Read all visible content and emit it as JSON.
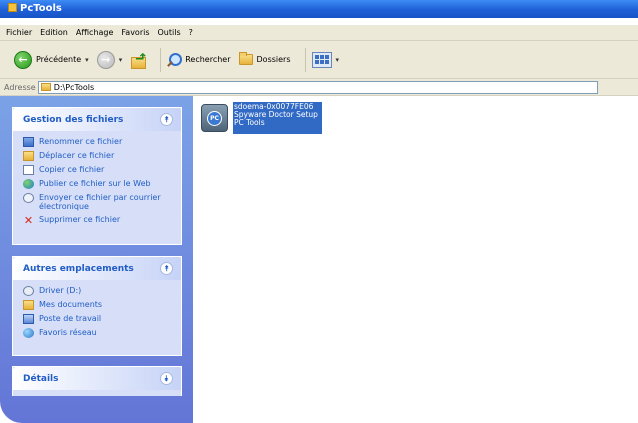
{
  "window": {
    "title": "PcTools"
  },
  "menu": [
    "Fichier",
    "Edition",
    "Affichage",
    "Favoris",
    "Outils",
    "?"
  ],
  "toolbar": {
    "back_label": "Précédente",
    "search_label": "Rechercher",
    "folders_label": "Dossiers"
  },
  "address": {
    "label": "Adresse",
    "path": "D:\\PcTools"
  },
  "tasks_panel": {
    "title": "Gestion des fichiers",
    "items": [
      {
        "label": "Renommer ce fichier",
        "icon": "rename-icon"
      },
      {
        "label": "Déplacer ce fichier",
        "icon": "move-icon"
      },
      {
        "label": "Copier ce fichier",
        "icon": "copy-icon"
      },
      {
        "label": "Publier ce fichier sur le Web",
        "icon": "web-publish-icon"
      },
      {
        "label": "Envoyer ce fichier par courrier électronique",
        "icon": "email-icon"
      },
      {
        "label": "Supprimer ce fichier",
        "icon": "delete-icon"
      }
    ]
  },
  "places_panel": {
    "title": "Autres emplacements",
    "items": [
      {
        "label": "Driver (D:)",
        "icon": "drive-icon"
      },
      {
        "label": "Mes documents",
        "icon": "documents-folder-icon"
      },
      {
        "label": "Poste de travail",
        "icon": "my-computer-icon"
      },
      {
        "label": "Favoris réseau",
        "icon": "network-icon"
      }
    ]
  },
  "details_panel": {
    "title": "Détails"
  },
  "file": {
    "name": "sdoema-0x0077FE06",
    "line2": "Spyware Doctor Setup",
    "line3": "PC Tools"
  }
}
